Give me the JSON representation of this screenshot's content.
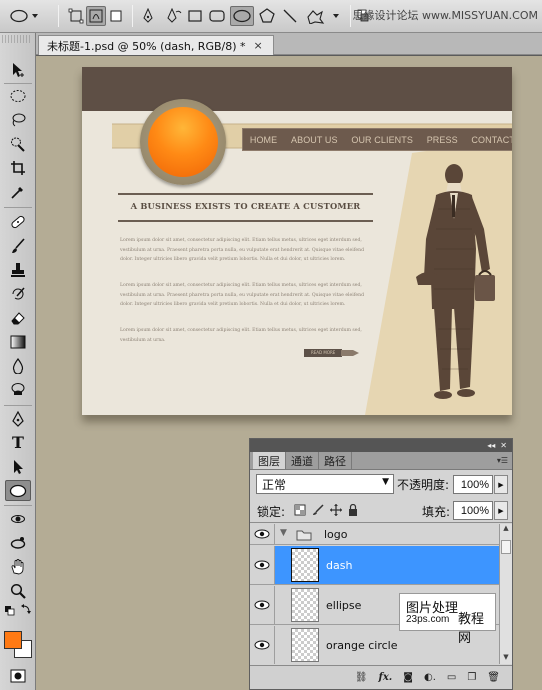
{
  "options_bar": {
    "tools": [
      "ellipse-tool-preset",
      "shape-layers",
      "paths",
      "fill-pixels",
      "pen",
      "freeform-pen",
      "rectangle",
      "rounded-rectangle",
      "ellipse",
      "polygon",
      "line",
      "custom-shape"
    ],
    "selected_shape": "ellipse",
    "watermark": "思缘设计论坛 www.MISSYUAN.COM"
  },
  "document_tab": {
    "title": "未标题-1.psd @ 50% (dash, RGB/8) *",
    "close": "×"
  },
  "colors": {
    "foreground": "#ff7a14",
    "background": "#ffffff",
    "selection": "#3d95ff"
  },
  "design": {
    "nav": [
      "HOME",
      "ABOUT US",
      "OUR CLIENTS",
      "PRESS",
      "CONTACT US"
    ],
    "headline": "A BUSINESS EXISTS TO CREATE A CUSTOMER",
    "paragraphs": [
      "Lorem ipsum dolor sit amet, consectetur adipiscing elit. Etiam tellus metus, ultrices eget interdum sed, vestibulum at urna. Praesent pharetra porta nulla, eu vulputate erat hendrerit at. Quisque vitae eleifend dolor. Integer ultricies libero gravida velit pretium lobortis. Nulla et dui dolor, ut ultricies lorem.",
      "Lorem ipsum dolor sit amet, consectetur adipiscing elit. Etiam tellus metus, ultrices eget interdum sed, vestibulum at urna. Praesent pharetra porta nulla, eu vulputate erat hendrerit at. Quisque vitae eleifend dolor. Integer ultricies libero gravida velit pretium lobortis. Nulla et dui dolor, ut ultricies lorem.",
      "Lorem ipsum dolor sit amet, consectetur adipiscing elit. Etiam tellus metus, ultrices eget interdum sed, vestibulum at urna."
    ],
    "more_button": "READ MORE"
  },
  "layers_panel": {
    "tabs": [
      "图层",
      "通道",
      "路径"
    ],
    "active_tab": "图层",
    "blend_mode": "正常",
    "opacity_label": "不透明度:",
    "opacity_value": "100%",
    "lock_label": "锁定:",
    "fill_label": "填充:",
    "fill_value": "100%",
    "group": "logo",
    "layers": [
      {
        "name": "dash",
        "selected": true
      },
      {
        "name": "ellipse",
        "selected": false
      },
      {
        "name": "orange circle",
        "selected": false
      }
    ],
    "footer_icons": [
      "link-layers",
      "fx",
      "add-mask",
      "new-adjustment",
      "new-group",
      "new-layer",
      "delete-layer"
    ]
  },
  "overlay_watermark": {
    "line1": "图片处理",
    "line2": "23ps.com",
    "line3": "教程网"
  }
}
